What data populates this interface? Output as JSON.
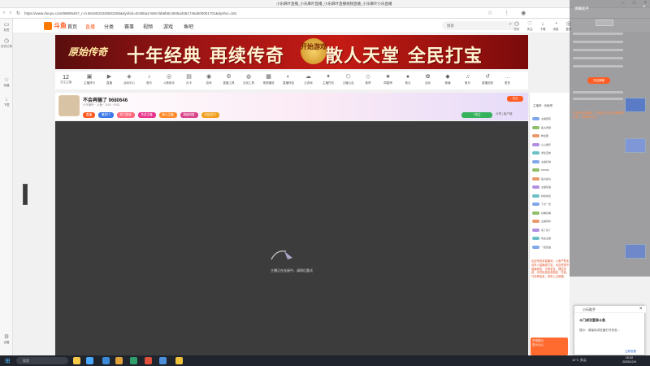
{
  "browser": {
    "window_title": "小乐麻叶直播_小乐麻叶直播_小乐麻叶直播视频直播_小乐麻叶小乐直播",
    "url": "https://www.douyu.com/9680646?_r=0.6516533325503255&dyshid=0c56ba2-846-fab8b8c4505a4061746ab00051701&dyshci=181",
    "left_sidebar": [
      {
        "label": "标签"
      },
      {
        "label": "历史记录"
      },
      {
        "label": "收藏"
      },
      {
        "label": "下载"
      },
      {
        "label": "设置"
      }
    ]
  },
  "header": {
    "logo": "斗鱼",
    "nav": [
      "首页",
      "直播",
      "分类",
      "赛事",
      "视频",
      "游戏",
      "鱼吧"
    ],
    "active_nav": "直播",
    "search_placeholder": "搜索",
    "icons": [
      {
        "label": "历史",
        "icon": "history-icon"
      },
      {
        "label": "关注",
        "icon": "heart-icon"
      },
      {
        "label": "下载",
        "icon": "download-icon"
      },
      {
        "label": "消息",
        "icon": "bell-icon"
      },
      {
        "label": "登录",
        "icon": "user-icon"
      }
    ]
  },
  "banner": {
    "brand": "原始传奇",
    "slogan_parts": [
      "十年经典",
      "再续传奇",
      "散人天堂",
      "全民打宝"
    ],
    "badge": "开始游戏"
  },
  "category_strip": {
    "follow_count": "12",
    "follow_label": "关注主播",
    "items": [
      "主播排行",
      "直播",
      "活动中心",
      "音乐",
      "斗鱼助手",
      "办卡",
      "游戏",
      "直播工具",
      "互动工具",
      "视频播放",
      "直播伴侣",
      "云游戏",
      "主播任务",
      "主播公会",
      "鱼吧",
      "周星榜",
      "鱼丸",
      "活动",
      "鱼塘",
      "鱼乐",
      "直播回放",
      "更多"
    ]
  },
  "streamer": {
    "name": "不会再输了 9680646",
    "meta": "小乐麻叶  · 斗鱼 · 1115 · 5761",
    "tags": [
      {
        "text": "直播",
        "color": "#ff5d23"
      },
      {
        "text": "最热门",
        "color": "#3b78e7"
      },
      {
        "text": "热门游戏",
        "color": "#ff6b7d"
      },
      {
        "text": "热游主播",
        "color": "#e8338a"
      },
      {
        "text": "新人主播",
        "color": "#ff8a2a"
      },
      {
        "text": "超级明星",
        "color": "#d8468a"
      },
      {
        "text": "分区热门",
        "color": "#f0a020"
      }
    ],
    "follow_btn": "关注",
    "hot_badge": "+关注",
    "right_info": "分享 | 客户端"
  },
  "player": {
    "loading_text": "主播正在连接中，请稍后重试"
  },
  "chat": {
    "tabs": "主播榜 · 贡献榜",
    "rows": [
      "主播回复",
      "鱼丸贡献",
      "粉丝团",
      "心心相印",
      "勇往直前",
      "主播好帅",
      "666666",
      "鱼丸鱼丸",
      "主播加油",
      "哈哈哈哈",
      "下次一定",
      "好看好看",
      "主播真棒",
      "来了来了",
      "欢迎主播",
      "一起加油"
    ],
    "announcement": "欢迎来到本直播间，斗鱼严禁未成年人直播或打赏，请自觉遵守直播规范，文明发言，理性消费，切勿轻信各类抽奖、兑换、代充等信息，谨防上当受骗。",
    "gift_label": "不再提示",
    "gift_sub": "送小心心"
  },
  "overlay": {
    "title": "弹幕助手",
    "orange_text": "欢迎来到直播间，主播正在为您准备精彩内容，请稍等片刻。",
    "button": "开启弹幕"
  },
  "dialog": {
    "header": "小乐助手",
    "title": "斗门成功登录斗鱼",
    "body": "提示：请保持浏览器打开状态...",
    "button": "立即查看"
  },
  "taskbar": {
    "search": "搜索",
    "tray": "11°C 多云",
    "time": "19:32",
    "date": "2025/12/4"
  }
}
